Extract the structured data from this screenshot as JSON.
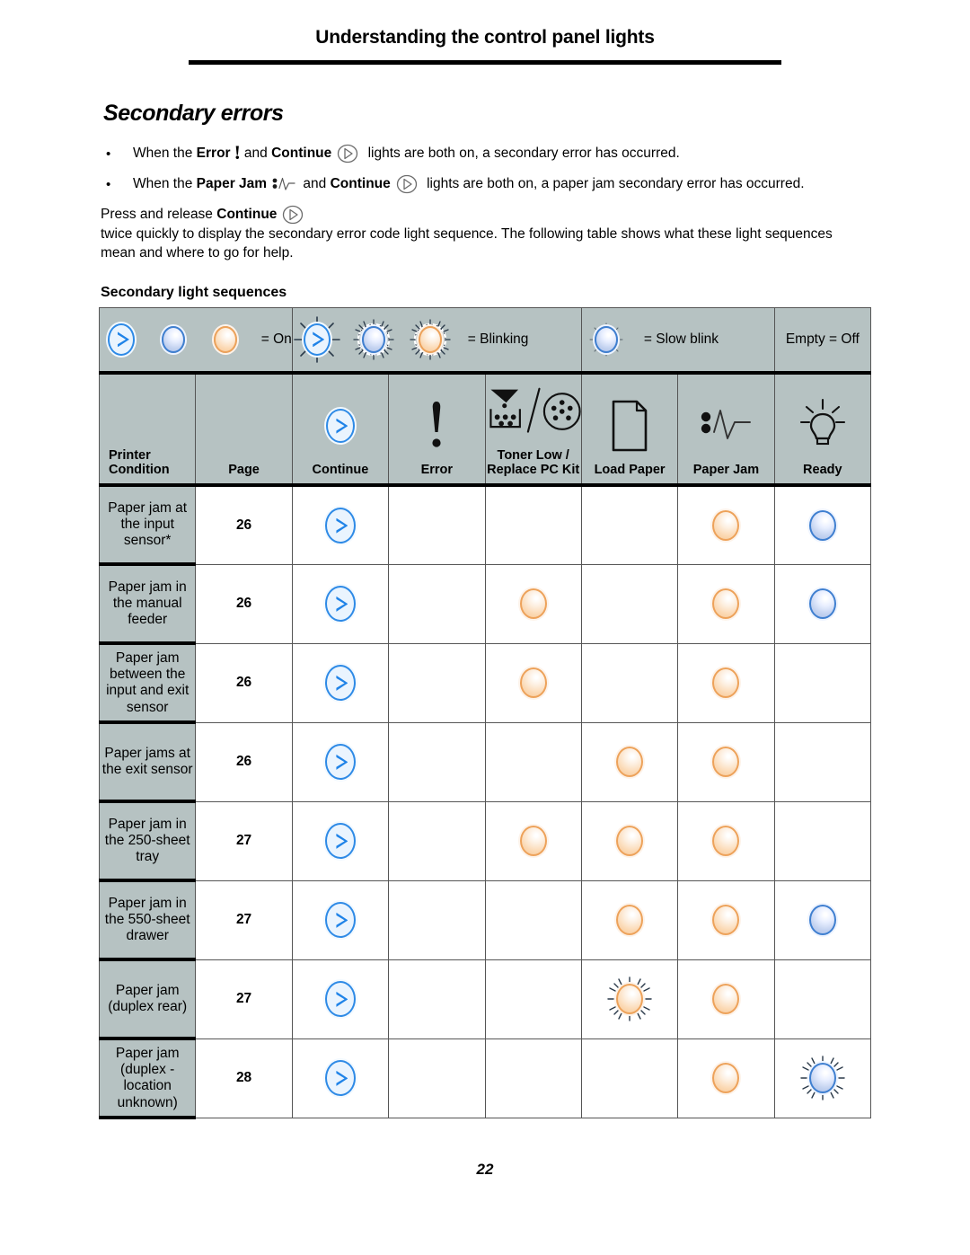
{
  "header": {
    "title": "Understanding the control panel lights"
  },
  "section": {
    "heading": "Secondary errors",
    "bullets": [
      {
        "pre": "When the",
        "bold1": "Error",
        "icon1": "error-exclamation-icon",
        "mid": "and",
        "bold2": "Continue",
        "icon2": "continue-button-icon",
        "post": "lights are both on, a secondary error has occurred."
      },
      {
        "pre": "When the",
        "bold1": "Paper Jam",
        "icon1": "paper-jam-icon",
        "mid": "and",
        "bold2": "Continue",
        "icon2": "continue-button-icon",
        "post": "lights are both on, a paper jam secondary error has occurred."
      }
    ],
    "paragraph": {
      "pre": "Press and release",
      "bold": "Continue",
      "icon": "continue-button-icon",
      "post": "twice quickly to display the secondary error code light sequence. The following table shows what these light sequences mean and where to go for help."
    },
    "table_caption": "Secondary light sequences"
  },
  "legend": {
    "on": {
      "label": "= On",
      "lamps": [
        "continue-blue",
        "blue",
        "orange"
      ]
    },
    "blinking": {
      "label": "= Blinking",
      "lamps": [
        "continue-blue-blink",
        "blue-blink",
        "orange-blink"
      ]
    },
    "slow_blink": {
      "label": "= Slow blink",
      "lamps": [
        "blue-slow-blink"
      ]
    },
    "empty": {
      "label": "Empty = Off"
    }
  },
  "table": {
    "columns": [
      {
        "label": "Printer Condition",
        "icon": ""
      },
      {
        "label": "Page",
        "icon": ""
      },
      {
        "label": "Continue",
        "icon": "continue-button-icon"
      },
      {
        "label": "Error",
        "icon": "error-exclamation-icon"
      },
      {
        "label": "Toner Low / Replace PC Kit",
        "icon": "toner-low-replace-pc-kit-icon"
      },
      {
        "label": "Load Paper",
        "icon": "load-paper-sheet-icon"
      },
      {
        "label": "Paper Jam",
        "icon": "paper-jam-icon"
      },
      {
        "label": "Ready",
        "icon": "ready-lightbulb-icon"
      }
    ],
    "rows": [
      {
        "condition": "Paper jam at the input sensor*",
        "page": "26",
        "lights": [
          "continue-on",
          "",
          "",
          "",
          "orange-on",
          "blue-on"
        ]
      },
      {
        "condition": "Paper jam in the manual feeder",
        "page": "26",
        "lights": [
          "continue-on",
          "",
          "orange-on",
          "",
          "orange-on",
          "blue-on"
        ]
      },
      {
        "condition": "Paper jam between the input and exit sensor",
        "page": "26",
        "lights": [
          "continue-on",
          "",
          "orange-on",
          "",
          "orange-on",
          ""
        ]
      },
      {
        "condition": "Paper jams at the exit sensor",
        "page": "26",
        "lights": [
          "continue-on",
          "",
          "",
          "orange-on",
          "orange-on",
          ""
        ]
      },
      {
        "condition": "Paper jam in the 250-sheet tray",
        "page": "27",
        "lights": [
          "continue-on",
          "",
          "orange-on",
          "orange-on",
          "orange-on",
          ""
        ]
      },
      {
        "condition": "Paper jam in the 550-sheet drawer",
        "page": "27",
        "lights": [
          "continue-on",
          "",
          "",
          "orange-on",
          "orange-on",
          "blue-on"
        ]
      },
      {
        "condition": "Paper jam (duplex rear)",
        "page": "27",
        "lights": [
          "continue-on",
          "",
          "",
          "orange-blink",
          "orange-on",
          ""
        ]
      },
      {
        "condition": "Paper jam (duplex - location unknown)",
        "page": "28",
        "lights": [
          "continue-on",
          "",
          "",
          "",
          "orange-on",
          "blue-blink"
        ]
      }
    ]
  },
  "footer": {
    "page_number": "22"
  },
  "colors": {
    "header_fill": "#b6c2c2",
    "lamp_blue_border": "#3f7fd0",
    "lamp_orange_border": "#eda25a",
    "continue_blue": "#2e8ae6"
  }
}
